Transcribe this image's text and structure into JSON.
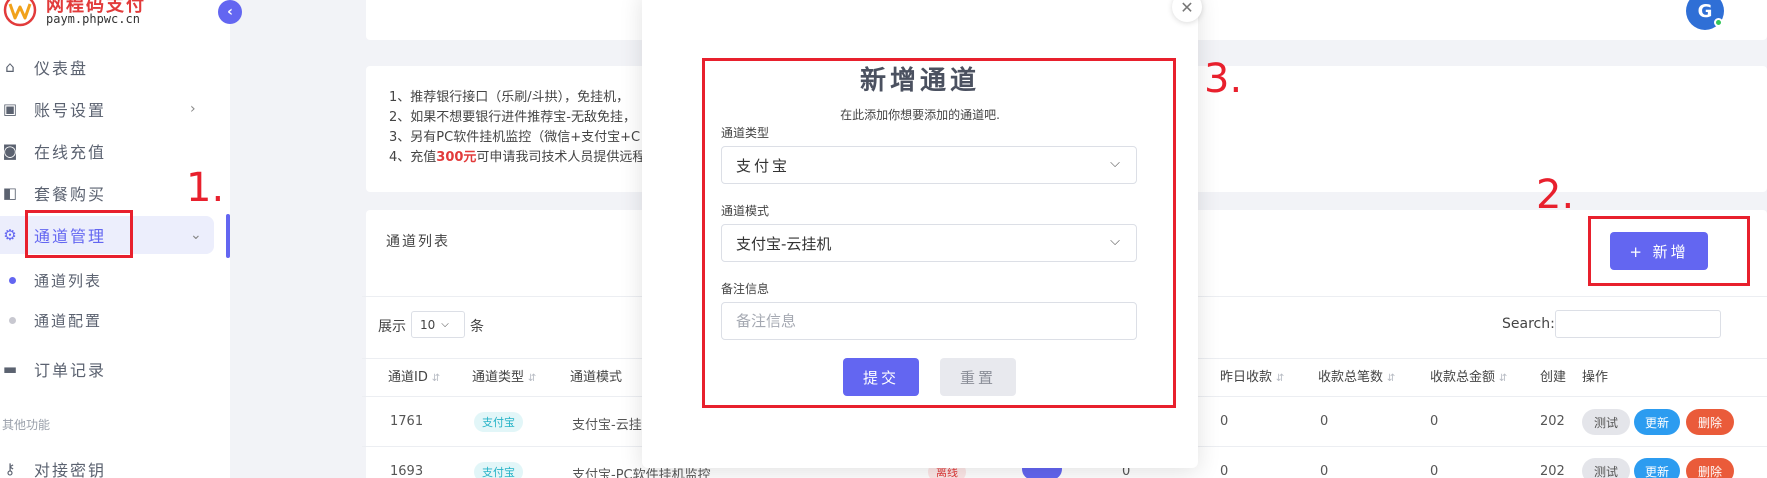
{
  "brand": {
    "title": "网程码支付",
    "subtitle": "paym.phpwc.cn"
  },
  "sidebar": {
    "items": [
      {
        "label": "仪表盘"
      },
      {
        "label": "账号设置"
      },
      {
        "label": "在线充值"
      },
      {
        "label": "套餐购买"
      },
      {
        "label": "通道管理"
      }
    ],
    "subitems": [
      {
        "label": "通道列表"
      },
      {
        "label": "通道配置"
      }
    ],
    "orders_label": "订单记录",
    "section_other": "其他功能",
    "api_key_label": "对接密钥"
  },
  "notice": {
    "line1": "1、推荐银行接口（乐刷/斗拱），免挂机，",
    "line2": "2、如果不想要银行进件推荐宝-无敌免挂，",
    "line3": "3、另有PC软件挂机监控（微信+支付宝+C",
    "line4_pre": "4、充值",
    "line4_red": "300元",
    "line4_post": "可申请我司技术人员提供远程"
  },
  "list": {
    "title": "通道列表",
    "add_button": "+ 新增",
    "show_label": "展示",
    "page_size": "10",
    "show_unit": "条",
    "search_label": "Search:"
  },
  "table": {
    "headers": {
      "id": "通道ID",
      "type": "通道类型",
      "mode": "通道模式",
      "yesterday": "昨日收款",
      "count": "收款总笔数",
      "amount": "收款总金额",
      "created": "创建",
      "ops": "操作"
    },
    "rows": [
      {
        "id": "1761",
        "type": "支付宝",
        "mode": "支付宝-云挂机",
        "yesterday": "0",
        "count": "0",
        "amount": "0",
        "created": "202"
      },
      {
        "id": "1693",
        "type": "支付宝",
        "mode": "支付宝-PC软件挂机监控",
        "status": "离线",
        "today": "0",
        "yesterday": "0",
        "count": "0",
        "amount": "0",
        "created": "202"
      }
    ],
    "op_test": "测试",
    "op_update": "更新",
    "op_delete": "删除"
  },
  "modal": {
    "title": "新增通道",
    "subtitle": "在此添加你想要添加的通道吧.",
    "type_label": "通道类型",
    "type_value": "支付宝",
    "mode_label": "通道模式",
    "mode_value": "支付宝-云挂机",
    "remark_label": "备注信息",
    "remark_placeholder": "备注信息",
    "submit": "提交",
    "reset": "重置"
  },
  "annotations": {
    "step1": "1.",
    "step2": "2.",
    "step3": "3."
  },
  "colors": {
    "accent": "#6366f1",
    "annotation": "#e8202d",
    "danger": "#ea5b3a",
    "info": "#2c9cf0"
  }
}
